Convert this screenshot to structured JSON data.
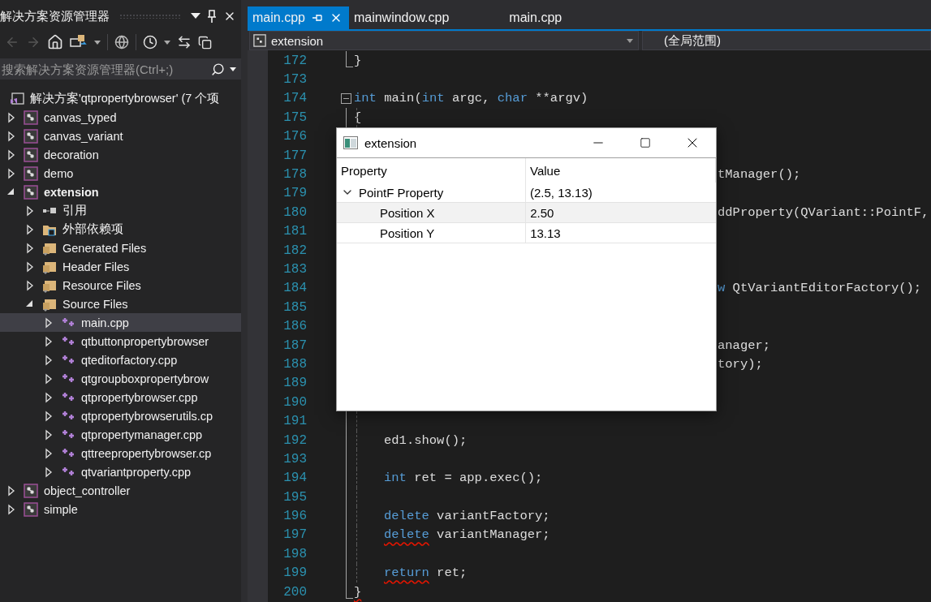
{
  "sidebar": {
    "title": "解决方案资源管理器",
    "search": {
      "placeholder": "搜索解决方案资源管理器(Ctrl+;)"
    },
    "tree": [
      {
        "label": "解决方案'qtpropertybrowser' (7 个项",
        "kind": "solution",
        "selected": false
      },
      {
        "label": "canvas_typed",
        "kind": "project",
        "startup": false,
        "expanded": false,
        "selected": false
      },
      {
        "label": "canvas_variant",
        "kind": "project",
        "startup": false,
        "expanded": false,
        "selected": false
      },
      {
        "label": "decoration",
        "kind": "project",
        "startup": false,
        "expanded": false,
        "selected": false
      },
      {
        "label": "demo",
        "kind": "project",
        "startup": false,
        "expanded": false,
        "selected": false
      },
      {
        "label": "extension",
        "kind": "project",
        "startup": true,
        "expanded": true,
        "selected": false,
        "children": [
          {
            "label": "引用",
            "kind": "references",
            "expanded": false,
            "selected": false
          },
          {
            "label": "外部依赖项",
            "kind": "external",
            "expanded": false,
            "selected": false
          },
          {
            "label": "Generated Files",
            "kind": "filter",
            "expanded": false,
            "selected": false
          },
          {
            "label": "Header Files",
            "kind": "filter",
            "expanded": false,
            "selected": false
          },
          {
            "label": "Resource Files",
            "kind": "filter",
            "expanded": false,
            "selected": false
          },
          {
            "label": "Source Files",
            "kind": "filter",
            "expanded": true,
            "selected": false,
            "children": [
              {
                "label": "main.cpp",
                "kind": "file",
                "expanded": false,
                "selected": true
              },
              {
                "label": "qtbuttonpropertybrowser",
                "kind": "file",
                "expanded": false,
                "selected": false
              },
              {
                "label": "qteditorfactory.cpp",
                "kind": "file",
                "expanded": false,
                "selected": false
              },
              {
                "label": "qtgroupboxpropertybrow",
                "kind": "file",
                "expanded": false,
                "selected": false
              },
              {
                "label": "qtpropertybrowser.cpp",
                "kind": "file",
                "expanded": false,
                "selected": false
              },
              {
                "label": "qtpropertybrowserutils.cp",
                "kind": "file",
                "expanded": false,
                "selected": false
              },
              {
                "label": "qtpropertymanager.cpp",
                "kind": "file",
                "expanded": false,
                "selected": false
              },
              {
                "label": "qttreepropertybrowser.cp",
                "kind": "file",
                "expanded": false,
                "selected": false
              },
              {
                "label": "qtvariantproperty.cpp",
                "kind": "file",
                "expanded": false,
                "selected": false
              }
            ]
          }
        ]
      },
      {
        "label": "object_controller",
        "kind": "project",
        "startup": false,
        "expanded": false,
        "selected": false
      },
      {
        "label": "simple",
        "kind": "project",
        "startup": false,
        "expanded": false,
        "selected": false
      }
    ]
  },
  "tabs": [
    {
      "label": "main.cpp",
      "selected": true,
      "pinned": true
    },
    {
      "label": "mainwindow.cpp",
      "selected": false,
      "pinned": false
    },
    {
      "label": "main.cpp",
      "selected": false,
      "pinned": false
    }
  ],
  "navigation": {
    "scope": "extension",
    "member": "(全局范围)"
  },
  "code_lines": [
    {
      "number": "172",
      "kind": "block_end",
      "tokens": [
        {
          "text": "}",
          "kind": "plain"
        }
      ]
    },
    {
      "number": "173",
      "kind": "plain"
    },
    {
      "number": "174",
      "kind": "block_start",
      "tokens": [
        {
          "text": "int",
          "kind": "keyword"
        },
        {
          "text": " main(",
          "kind": "plain"
        },
        {
          "text": "int",
          "kind": "keyword"
        },
        {
          "text": " argc, ",
          "kind": "plain"
        },
        {
          "text": "char",
          "kind": "keyword"
        },
        {
          "text": " **argv)",
          "kind": "plain"
        }
      ]
    },
    {
      "number": "175",
      "kind": "block_body",
      "tokens": [
        {
          "text": "{",
          "kind": "plain"
        }
      ]
    },
    {
      "number": "176",
      "kind": "block_body"
    },
    {
      "number": "177",
      "kind": "block_body"
    },
    {
      "number": "178",
      "kind": "block_body",
      "partial": true,
      "tokens": [
        {
          "text": "tManager();",
          "kind": "plain"
        }
      ]
    },
    {
      "number": "179",
      "kind": "block_body"
    },
    {
      "number": "180",
      "kind": "block_body",
      "partial": true,
      "tokens": [
        {
          "text": "ddProperty(QVariant::PointF,",
          "kind": "plain"
        }
      ]
    },
    {
      "number": "181",
      "kind": "block_body"
    },
    {
      "number": "182",
      "kind": "block_body"
    },
    {
      "number": "183",
      "kind": "block_body"
    },
    {
      "number": "184",
      "kind": "block_body",
      "partial": true,
      "tokens": [
        {
          "text": "w",
          "kind": "keyword"
        },
        {
          "text": " QtVariantEditorFactory();",
          "kind": "plain"
        }
      ]
    },
    {
      "number": "185",
      "kind": "block_body"
    },
    {
      "number": "186",
      "kind": "block_body"
    },
    {
      "number": "187",
      "kind": "block_body",
      "partial": true,
      "tokens": [
        {
          "text": "anager;",
          "kind": "plain"
        }
      ]
    },
    {
      "number": "188",
      "kind": "block_body",
      "partial": true,
      "tokens": [
        {
          "text": "tory);",
          "kind": "plain"
        }
      ]
    },
    {
      "number": "189",
      "kind": "block_body"
    },
    {
      "number": "190",
      "kind": "block_body"
    },
    {
      "number": "191",
      "kind": "block_body"
    },
    {
      "number": "192",
      "kind": "block_body",
      "indented": true,
      "tokens": [
        {
          "text": "ed1.show();",
          "kind": "plain"
        }
      ]
    },
    {
      "number": "193",
      "kind": "block_body"
    },
    {
      "number": "194",
      "kind": "block_body",
      "indented": true,
      "tokens": [
        {
          "text": "int",
          "kind": "keyword"
        },
        {
          "text": " ret = app.exec();",
          "kind": "plain"
        }
      ]
    },
    {
      "number": "195",
      "kind": "block_body"
    },
    {
      "number": "196",
      "kind": "block_body",
      "indented": true,
      "tokens": [
        {
          "text": "delete",
          "kind": "keyword"
        },
        {
          "text": " variantFactory;",
          "kind": "plain"
        }
      ]
    },
    {
      "number": "197",
      "kind": "block_body",
      "indented": true,
      "tokens": [
        {
          "text": "delete",
          "kind": "keyword",
          "error": true
        },
        {
          "text": " variantManager;",
          "kind": "plain"
        }
      ]
    },
    {
      "number": "198",
      "kind": "block_body"
    },
    {
      "number": "199",
      "kind": "block_body",
      "indented": true,
      "tokens": [
        {
          "text": "return",
          "kind": "keyword",
          "error": true
        },
        {
          "text": " ret;",
          "kind": "plain"
        }
      ]
    },
    {
      "number": "200",
      "kind": "block_end",
      "tokens": [
        {
          "text": "}",
          "kind": "plain",
          "error": true
        }
      ]
    }
  ],
  "dialog": {
    "title": "extension",
    "columns": [
      "Property",
      "Value"
    ],
    "rows": [
      {
        "name": "PointF Property",
        "value": "(2.5, 13.13)",
        "expanded": true,
        "selected": false,
        "children": [
          {
            "name": "Position X",
            "value": "2.50",
            "selected": true
          },
          {
            "name": "Position Y",
            "value": "13.13",
            "selected": false
          }
        ]
      }
    ]
  }
}
